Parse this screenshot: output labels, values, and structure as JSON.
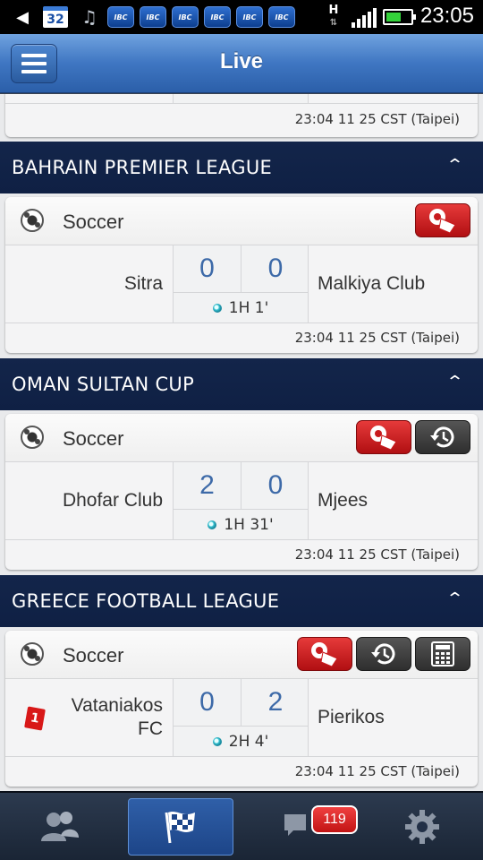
{
  "status_bar": {
    "calendar_day": "32",
    "app_icon_label": "IBC",
    "network_type": "H",
    "time": "23:05"
  },
  "header": {
    "title": "Live"
  },
  "top_partial_card": {
    "timestamp": "23:04 11 25 CST (Taipei)"
  },
  "leagues": [
    {
      "name": "BAHRAIN PREMIER LEAGUE",
      "match": {
        "sport": "Soccer",
        "sport_icon": "soccer-ball-icon",
        "home_team": "Sitra",
        "away_team": "Malkiya Club",
        "home_score": "0",
        "away_score": "0",
        "period": "1H 1'",
        "timestamp": "23:04 11 25 CST (Taipei)",
        "buttons": [
          "live-bet-icon"
        ]
      }
    },
    {
      "name": "OMAN SULTAN CUP",
      "match": {
        "sport": "Soccer",
        "sport_icon": "soccer-ball-icon",
        "home_team": "Dhofar Club",
        "away_team": "Mjees",
        "home_score": "2",
        "away_score": "0",
        "period": "1H 31'",
        "timestamp": "23:04 11 25 CST (Taipei)",
        "buttons": [
          "live-bet-icon",
          "history-icon"
        ]
      }
    },
    {
      "name": "GREECE FOOTBALL LEAGUE",
      "match": {
        "sport": "Soccer",
        "sport_icon": "soccer-ball-icon",
        "home_team": "Vataniakos FC",
        "home_team_line1": "Vataniakos",
        "home_team_line2": "FC",
        "home_red_cards": "1",
        "away_team": "Pierikos",
        "home_score": "0",
        "away_score": "2",
        "period": "2H 4'",
        "timestamp": "23:04 11 25 CST (Taipei)",
        "buttons": [
          "live-bet-icon",
          "history-icon",
          "calculator-icon"
        ]
      }
    }
  ],
  "bottom_nav": {
    "items": [
      {
        "icon": "users-icon",
        "active": false
      },
      {
        "icon": "checkered-flag-icon",
        "active": true
      },
      {
        "icon": "chat-icon",
        "active": false,
        "badge": "119"
      },
      {
        "icon": "gear-icon",
        "active": false
      }
    ]
  },
  "colors": {
    "header_blue": "#3f76c2",
    "league_navy": "#13254a",
    "score_blue": "#3d6aa8",
    "action_red": "#c81b1e",
    "live_dot": "#38c3d3"
  }
}
